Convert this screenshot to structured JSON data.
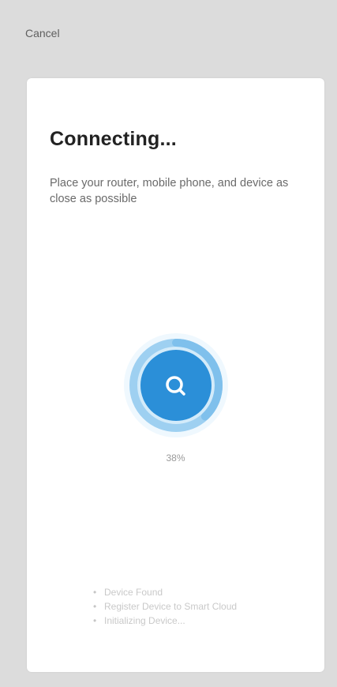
{
  "header": {
    "cancel_label": "Cancel"
  },
  "card": {
    "title": "Connecting...",
    "subtitle": "Place your router, mobile phone, and device as close as possible"
  },
  "progress": {
    "value_label": "38%",
    "value": 0.38,
    "accent_color": "#2b8fd8",
    "ring_color": "#7fc0ec",
    "glow_color": "#d3ebfa",
    "icon": "search-icon"
  },
  "steps": [
    {
      "label": "Device Found",
      "bullet": "•"
    },
    {
      "label": "Register Device to Smart Cloud",
      "bullet": "•"
    },
    {
      "label": "Initializing Device...",
      "bullet": "•"
    }
  ]
}
